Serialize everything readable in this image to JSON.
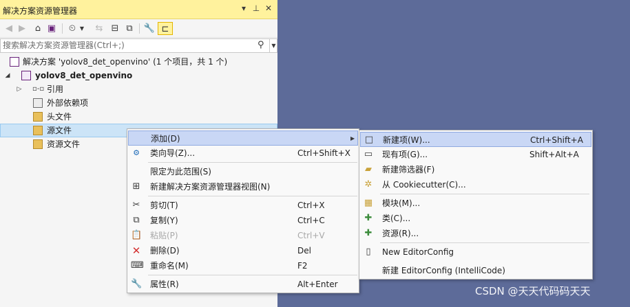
{
  "panel": {
    "title": "解决方案资源管理器",
    "title_controls": [
      "▾",
      "ᵖ",
      "✕"
    ],
    "search_placeholder": "搜索解决方案资源管理器(Ctrl+;)"
  },
  "toolbar": {
    "buttons": [
      "back-icon",
      "forward-icon",
      "home-icon",
      "switch-views-icon",
      "history-icon",
      "dropdown-icon",
      "sync-icon",
      "collapse-all-icon",
      "show-all-files-icon",
      "properties-wrench-icon",
      "preview-icon"
    ]
  },
  "tree": {
    "solution": "解决方案 'yolov8_det_openvino' (1 个项目，共 1 个)",
    "project": "yolov8_det_openvino",
    "items": [
      "引用",
      "外部依赖项",
      "头文件",
      "源文件",
      "资源文件"
    ]
  },
  "context_menu": {
    "items": [
      {
        "label": "添加(D)",
        "shortcut": "",
        "icon": "none"
      },
      {
        "label": "类向导(Z)...",
        "shortcut": "Ctrl+Shift+X",
        "icon": "class-wizard-icon"
      },
      {
        "label": "限定为此范围(S)",
        "shortcut": "",
        "icon": "none"
      },
      {
        "label": "新建解决方案资源管理器视图(N)",
        "shortcut": "",
        "icon": "new-view-icon"
      },
      {
        "label": "剪切(T)",
        "shortcut": "Ctrl+X",
        "icon": "cut-icon"
      },
      {
        "label": "复制(Y)",
        "shortcut": "Ctrl+C",
        "icon": "copy-icon"
      },
      {
        "label": "粘贴(P)",
        "shortcut": "Ctrl+V",
        "icon": "paste-icon"
      },
      {
        "label": "删除(D)",
        "shortcut": "Del",
        "icon": "delete-icon"
      },
      {
        "label": "重命名(M)",
        "shortcut": "F2",
        "icon": "rename-icon"
      },
      {
        "label": "属性(R)",
        "shortcut": "Alt+Enter",
        "icon": "properties-icon"
      }
    ]
  },
  "submenu": {
    "items": [
      {
        "label": "新建项(W)...",
        "shortcut": "Ctrl+Shift+A"
      },
      {
        "label": "现有项(G)...",
        "shortcut": "Shift+Alt+A"
      },
      {
        "label": "新建筛选器(F)",
        "shortcut": ""
      },
      {
        "label": "从 Cookiecutter(C)...",
        "shortcut": ""
      },
      {
        "label": "模块(M)...",
        "shortcut": ""
      },
      {
        "label": "类(C)...",
        "shortcut": ""
      },
      {
        "label": "资源(R)...",
        "shortcut": ""
      },
      {
        "label": "New EditorConfig",
        "shortcut": ""
      },
      {
        "label": "新建 EditorConfig (IntelliCode)",
        "shortcut": ""
      }
    ]
  },
  "watermark": "CSDN @天天代码码天天",
  "colors": {
    "background": "#5d6b99",
    "title_bar": "#fff29d",
    "menu_highlight": "#c9d7f5",
    "selection": "#cce4f7"
  }
}
